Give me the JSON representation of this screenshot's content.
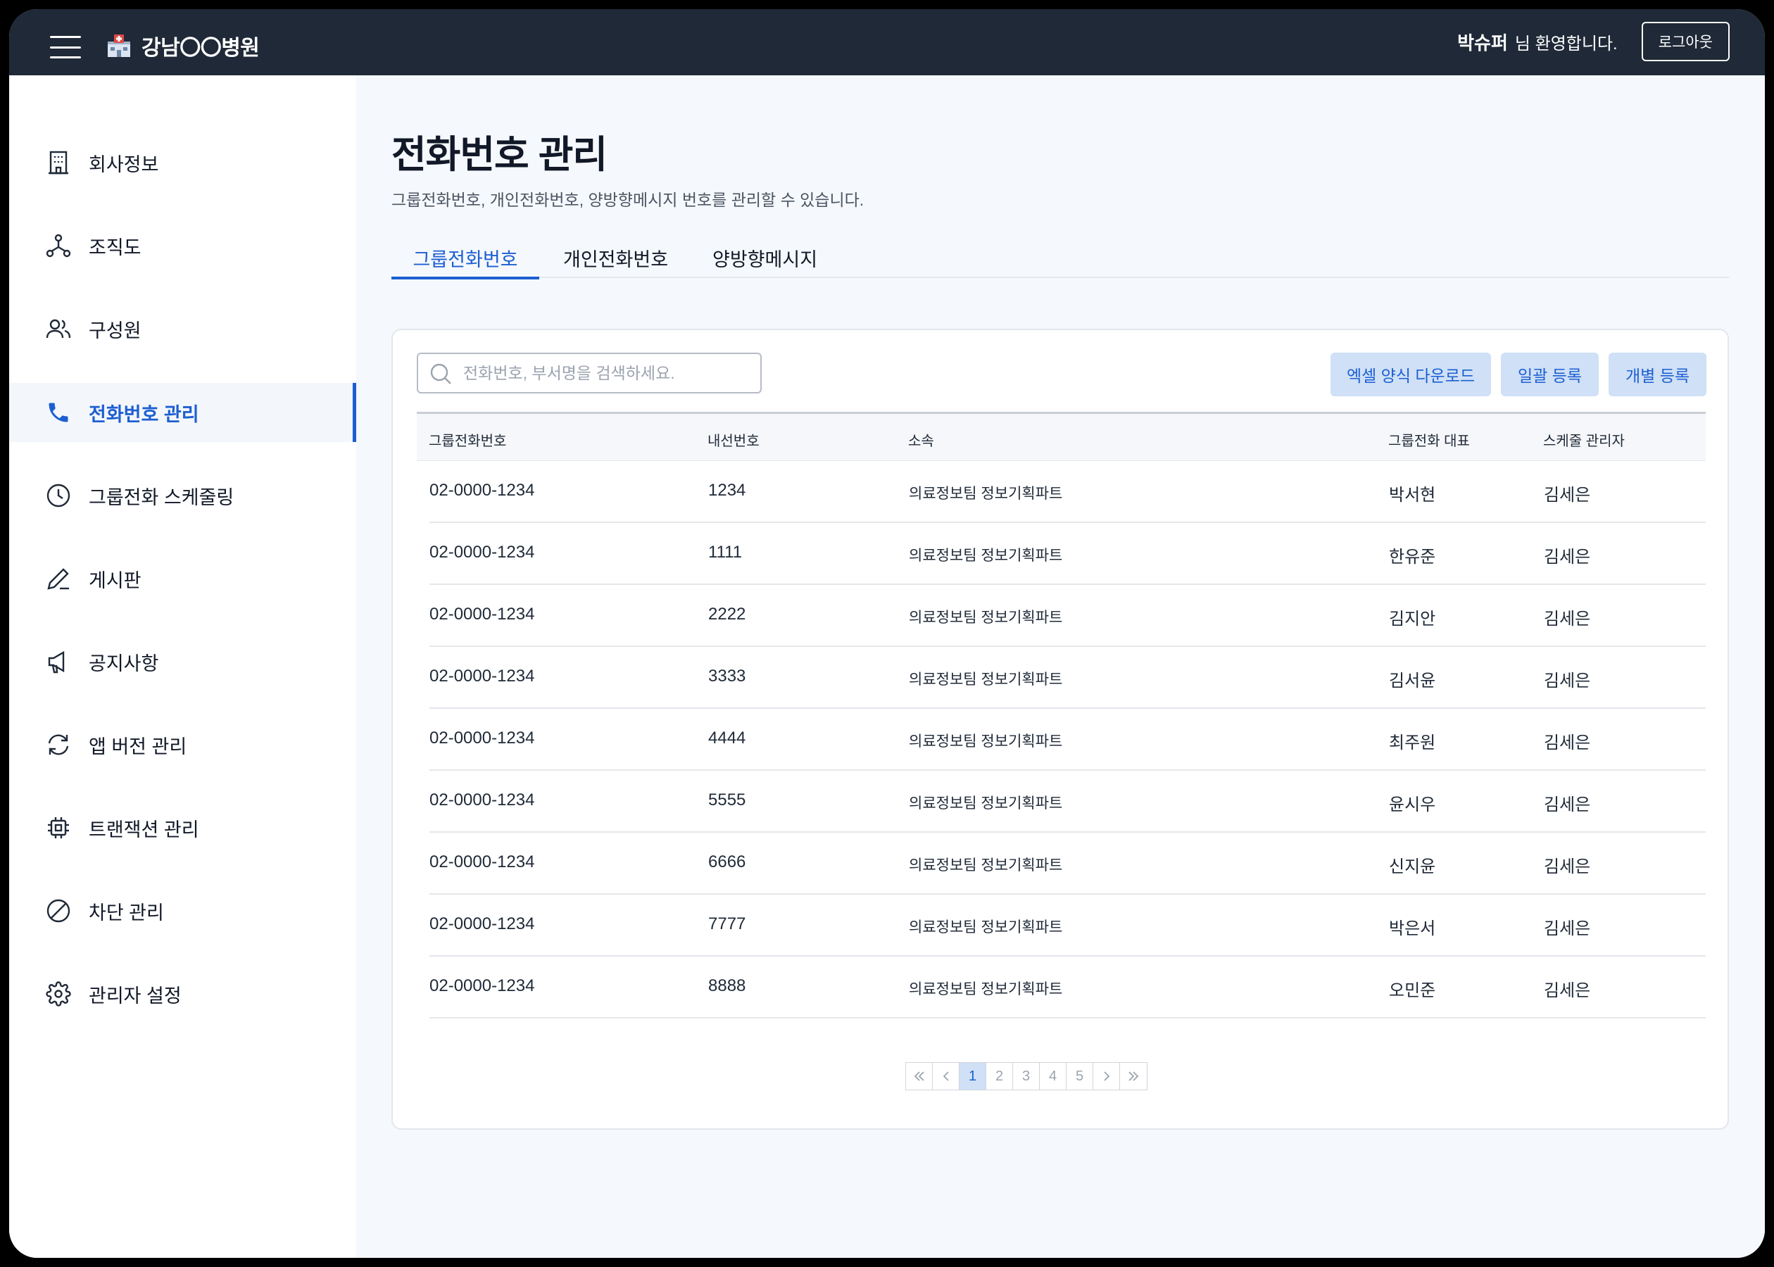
{
  "header": {
    "brand": "강남〇〇병원",
    "user_name": "박슈퍼",
    "welcome_suffix": "님 환영합니다.",
    "logout_label": "로그아웃"
  },
  "sidebar": {
    "items": [
      {
        "label": "회사정보",
        "icon": "building-icon"
      },
      {
        "label": "조직도",
        "icon": "org-chart-icon"
      },
      {
        "label": "구성원",
        "icon": "users-icon"
      },
      {
        "label": "전화번호 관리",
        "icon": "phone-icon",
        "active": true
      },
      {
        "label": "그룹전화 스케줄링",
        "icon": "clock-icon"
      },
      {
        "label": "게시판",
        "icon": "pen-icon"
      },
      {
        "label": "공지사항",
        "icon": "megaphone-icon"
      },
      {
        "label": "앱 버전 관리",
        "icon": "refresh-icon"
      },
      {
        "label": "트랜잭션 관리",
        "icon": "chip-icon"
      },
      {
        "label": "차단 관리",
        "icon": "block-icon"
      },
      {
        "label": "관리자 설정",
        "icon": "gear-icon"
      }
    ]
  },
  "page": {
    "title": "전화번호 관리",
    "description": "그룹전화번호, 개인전화번호, 양방향메시지 번호를 관리할 수 있습니다."
  },
  "tabs": [
    {
      "label": "그룹전화번호",
      "active": true
    },
    {
      "label": "개인전화번호"
    },
    {
      "label": "양방향메시지"
    }
  ],
  "search": {
    "placeholder": "전화번호, 부서명을 검색하세요."
  },
  "actions": {
    "excel_download": "엑셀 양식 다운로드",
    "bulk_register": "일괄 등록",
    "single_register": "개별 등록"
  },
  "table": {
    "columns": [
      "그룹전화번호",
      "내선번호",
      "소속",
      "그룹전화 대표",
      "스케줄 관리자"
    ],
    "rows": [
      [
        "02-0000-1234",
        "1234",
        "의료정보팀 정보기획파트",
        "박서현",
        "김세은"
      ],
      [
        "02-0000-1234",
        "1111",
        "의료정보팀 정보기획파트",
        "한유준",
        "김세은"
      ],
      [
        "02-0000-1234",
        "2222",
        "의료정보팀 정보기획파트",
        "김지안",
        "김세은"
      ],
      [
        "02-0000-1234",
        "3333",
        "의료정보팀 정보기획파트",
        "김서윤",
        "김세은"
      ],
      [
        "02-0000-1234",
        "4444",
        "의료정보팀 정보기획파트",
        "최주원",
        "김세은"
      ],
      [
        "02-0000-1234",
        "5555",
        "의료정보팀 정보기획파트",
        "윤시우",
        "김세은"
      ],
      [
        "02-0000-1234",
        "6666",
        "의료정보팀 정보기획파트",
        "신지윤",
        "김세은"
      ],
      [
        "02-0000-1234",
        "7777",
        "의료정보팀 정보기획파트",
        "박은서",
        "김세은"
      ],
      [
        "02-0000-1234",
        "8888",
        "의료정보팀 정보기획파트",
        "오민준",
        "김세은"
      ]
    ]
  },
  "pagination": {
    "pages": [
      "1",
      "2",
      "3",
      "4",
      "5"
    ],
    "current": "1"
  },
  "colors": {
    "header_bg": "#1f2937",
    "accent": "#1d5fd1",
    "button_bg": "#cfe0f7",
    "main_bg": "#f5f8fc"
  }
}
